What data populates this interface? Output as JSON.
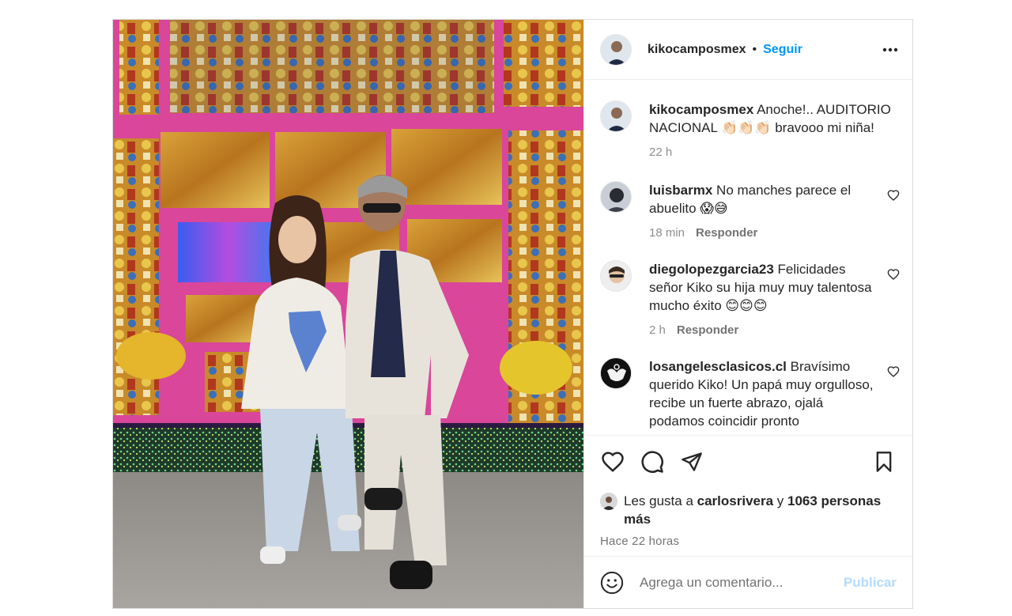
{
  "post": {
    "author": "kikocamposmex",
    "separator": "•",
    "follow_label": "Seguir",
    "more_icon": "ellipsis-icon",
    "photo_alt": "Post photo",
    "caption": {
      "user": "kikocamposmex",
      "text": "Anoche!.. AUDITORIO NACIONAL 👏🏻👏🏻👏🏻 bravooo mi niña!",
      "time": "22 h"
    },
    "comments": [
      {
        "user": "luisbarmx",
        "text": "No manches parece el abuelito 😱😅",
        "time": "18 min",
        "reply": "Responder"
      },
      {
        "user": "diegolopezgarcia23",
        "text": "Felicidades señor Kiko su hija muy muy talentosa mucho éxito 😊😊😊",
        "time": "2 h",
        "reply": "Responder"
      },
      {
        "user": "losangelesclasicos.cl",
        "text": "Bravísimo querido Kiko! Un papá muy orgulloso, recibe un fuerte abrazo, ojalá podamos coincidir pronto",
        "time": "",
        "reply": ""
      }
    ],
    "likes": {
      "prefix": "Les gusta a",
      "liker": "carlosrivera",
      "joiner": "y",
      "others": "1063 personas más"
    },
    "timestamp": "Hace 22 horas",
    "comment_placeholder": "Agrega un comentario...",
    "publish_label": "Publicar"
  },
  "colors": {
    "accent": "#0095f6",
    "publish_disabled": "#b3dbff",
    "muted": "#737373",
    "border": "#dbdbdb"
  }
}
